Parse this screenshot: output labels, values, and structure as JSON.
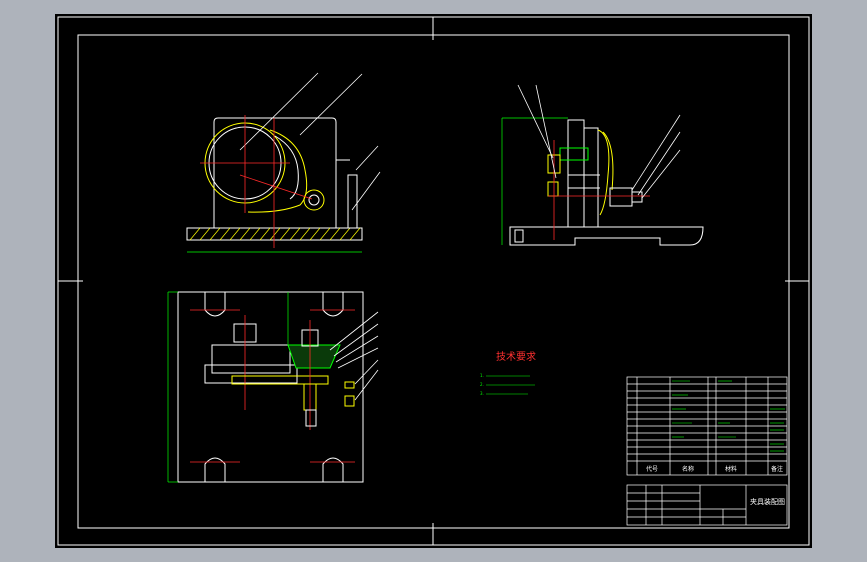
{
  "colors": {
    "background_outer": "#aeb3bb",
    "sheet": "#000000",
    "line_white": "#ffffff",
    "line_yellow": "#ffff00",
    "line_red": "#ff2a2a",
    "line_green": "#00ff00",
    "line_cyan": "#00ffff",
    "title_text": "#ff3030",
    "note_text": "#00ff00"
  },
  "technical_requirements": {
    "title": "技术要求",
    "notes": [
      "1.",
      "2.",
      "3."
    ]
  },
  "title_block": {
    "drawing_name": "夹具装配图",
    "header_code": "代号",
    "header_name": "名称",
    "header_material": "材料",
    "header_remark": "备注"
  },
  "icons": [
    "section-hatch",
    "leader-line",
    "balloon-number"
  ]
}
